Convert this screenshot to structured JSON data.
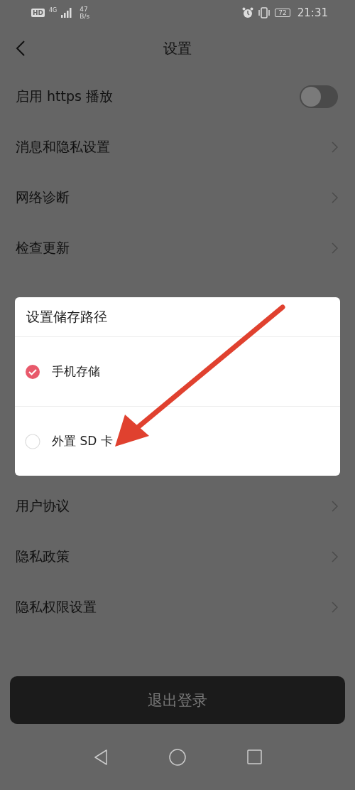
{
  "status_bar": {
    "hd": "HD",
    "network": "4G",
    "speed": "47",
    "speed_unit": "B/s",
    "battery": "72",
    "time": "21:31"
  },
  "header": {
    "title": "设置"
  },
  "settings_top": [
    {
      "label": "启用 https 播放",
      "kind": "toggle",
      "on": false
    },
    {
      "label": "消息和隐私设置",
      "kind": "link"
    },
    {
      "label": "网络诊断",
      "kind": "link"
    },
    {
      "label": "检查更新",
      "kind": "link"
    }
  ],
  "settings_bottom": [
    {
      "label": "用户协议",
      "kind": "link"
    },
    {
      "label": "隐私政策",
      "kind": "link"
    },
    {
      "label": "隐私权限设置",
      "kind": "link"
    }
  ],
  "dialog": {
    "title": "设置储存路径",
    "options": [
      {
        "label": "手机存储",
        "selected": true
      },
      {
        "label": "外置 SD 卡",
        "selected": false
      }
    ]
  },
  "logout_button": "退出登录"
}
